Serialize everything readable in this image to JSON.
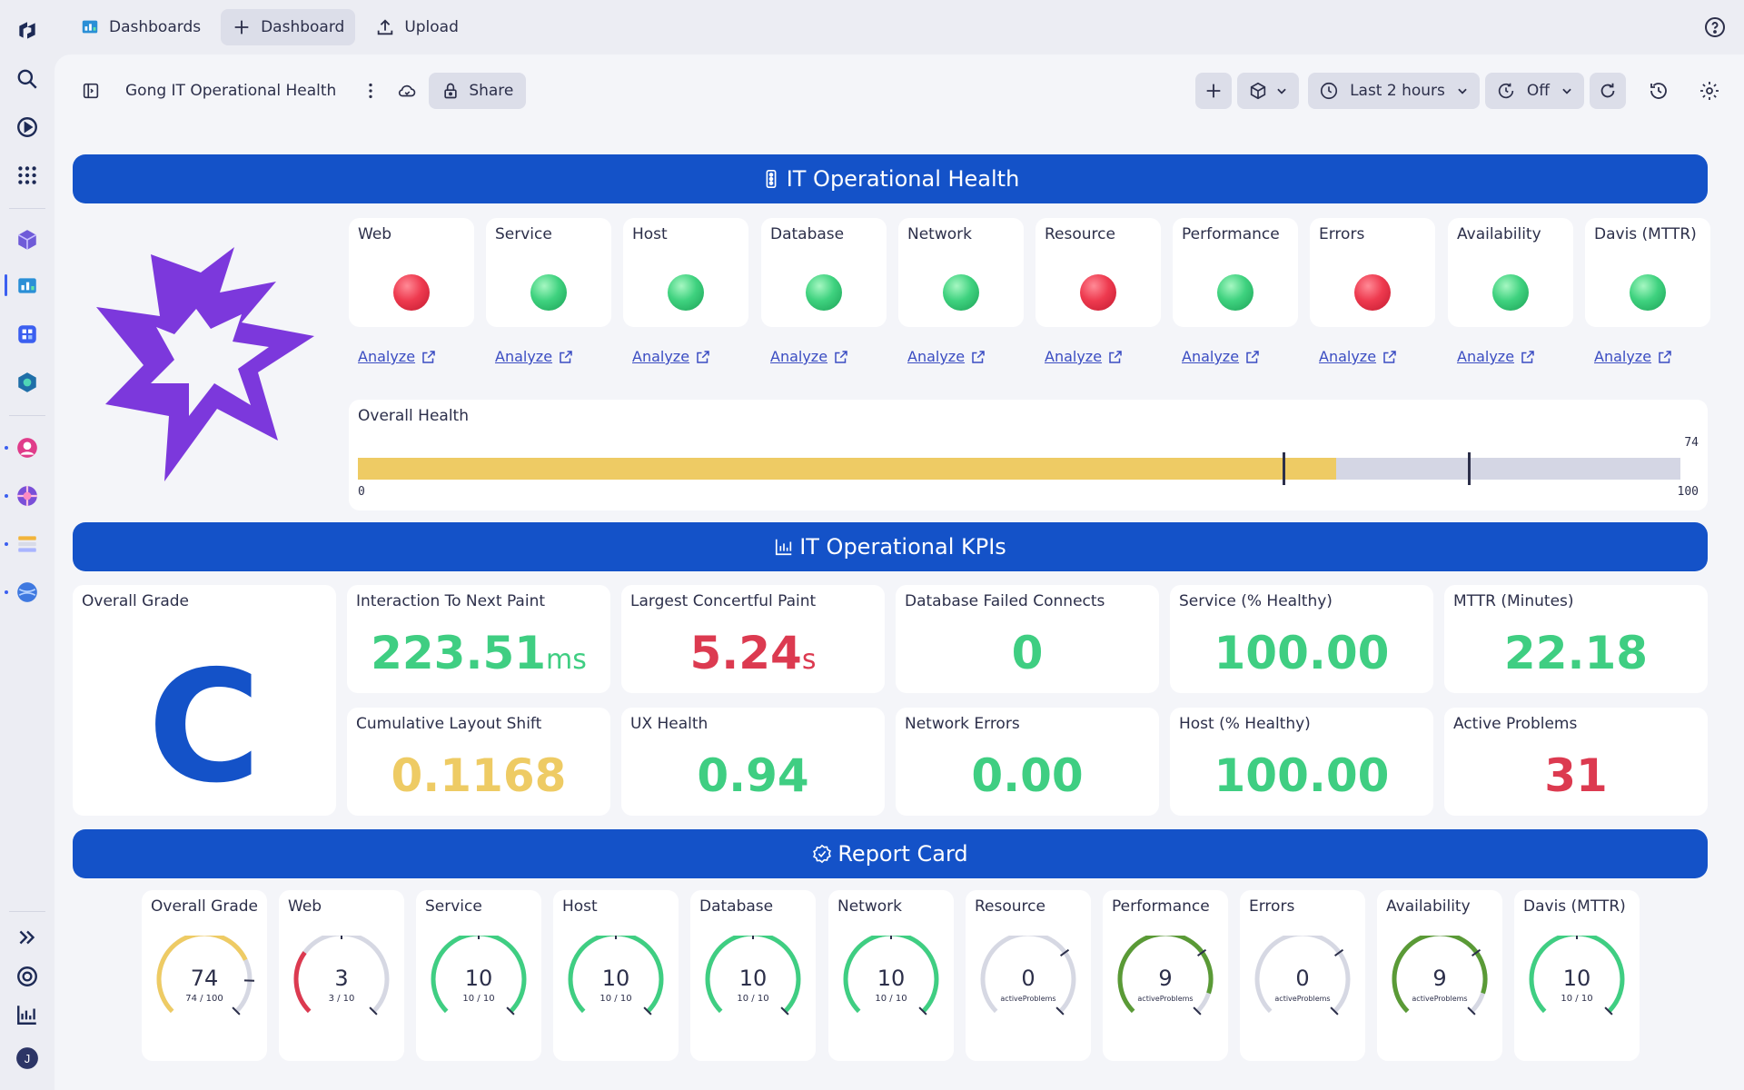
{
  "topbar": {
    "dashboards_label": "Dashboards",
    "new_dashboard_label": "Dashboard",
    "upload_label": "Upload"
  },
  "dashboard": {
    "title": "Gong IT Operational Health",
    "share_label": "Share",
    "timeframe_label": "Last 2 hours",
    "refresh_label": "Off"
  },
  "colors": {
    "header_blue": "#1452c8",
    "good_green": "#3fce82",
    "bad_red": "#dc3a50",
    "warn_yellow": "#eecb64",
    "olive_green": "#5a9a36"
  },
  "sections": {
    "health_title": "IT Operational Health",
    "kpi_title": "IT Operational KPIs",
    "report_title": "Report Card"
  },
  "health_tiles": [
    {
      "label": "Web",
      "status": "red",
      "analyze": "Analyze"
    },
    {
      "label": "Service",
      "status": "green",
      "analyze": "Analyze"
    },
    {
      "label": "Host",
      "status": "green",
      "analyze": "Analyze"
    },
    {
      "label": "Database",
      "status": "green",
      "analyze": "Analyze"
    },
    {
      "label": "Network",
      "status": "green",
      "analyze": "Analyze"
    },
    {
      "label": "Resource",
      "status": "red",
      "analyze": "Analyze"
    },
    {
      "label": "Performance",
      "status": "green",
      "analyze": "Analyze"
    },
    {
      "label": "Errors",
      "status": "red",
      "analyze": "Analyze"
    },
    {
      "label": "Availability",
      "status": "green",
      "analyze": "Analyze"
    },
    {
      "label": "Davis (MTTR)",
      "status": "green",
      "analyze": "Analyze"
    }
  ],
  "overall_health": {
    "label": "Overall Health",
    "value": 74,
    "value_label": "74",
    "min_label": "0",
    "max_label": "100",
    "min": 0,
    "max": 100,
    "thresholds": [
      70,
      84
    ]
  },
  "kpis": {
    "overall_grade_label": "Overall Grade",
    "overall_grade": "C",
    "items": [
      {
        "label": "Interaction To Next Paint",
        "value": "223.51",
        "unit": "ms",
        "color": "#3fce82"
      },
      {
        "label": "Largest Concertful Paint",
        "value": "5.24",
        "unit": "s",
        "color": "#dc3a50"
      },
      {
        "label": "Database Failed Connects",
        "value": "0",
        "unit": "",
        "color": "#3fce82"
      },
      {
        "label": "Service (% Healthy)",
        "value": "100.00",
        "unit": "",
        "color": "#3fce82"
      },
      {
        "label": "MTTR (Minutes)",
        "value": "22.18",
        "unit": "",
        "color": "#3fce82"
      },
      {
        "label": "Cumulative Layout Shift",
        "value": "0.1168",
        "unit": "",
        "color": "#eecb64"
      },
      {
        "label": "UX Health",
        "value": "0.94",
        "unit": "",
        "color": "#3fce82"
      },
      {
        "label": "Network Errors",
        "value": "0.00",
        "unit": "",
        "color": "#3fce82"
      },
      {
        "label": "Host (% Healthy)",
        "value": "100.00",
        "unit": "",
        "color": "#3fce82"
      },
      {
        "label": "Active Problems",
        "value": "31",
        "unit": "",
        "color": "#dc3a50"
      }
    ]
  },
  "report_card": [
    {
      "label": "Overall Grade",
      "value": "74",
      "sub": "74 / 100",
      "fraction": 0.74,
      "marker": 0.84,
      "color": "#eecb64"
    },
    {
      "label": "Web",
      "value": "3",
      "sub": "3 / 10",
      "fraction": 0.3,
      "marker": 0.5,
      "color": "#dc3a50"
    },
    {
      "label": "Service",
      "value": "10",
      "sub": "10 / 10",
      "fraction": 1.0,
      "marker": 0.5,
      "color": "#3fce82"
    },
    {
      "label": "Host",
      "value": "10",
      "sub": "10 / 10",
      "fraction": 1.0,
      "marker": 0.5,
      "color": "#3fce82"
    },
    {
      "label": "Database",
      "value": "10",
      "sub": "10 / 10",
      "fraction": 1.0,
      "marker": 0.5,
      "color": "#3fce82"
    },
    {
      "label": "Network",
      "value": "10",
      "sub": "10 / 10",
      "fraction": 1.0,
      "marker": 0.5,
      "color": "#3fce82"
    },
    {
      "label": "Resource",
      "value": "0",
      "sub": "activeProblems",
      "fraction": 0.0,
      "marker": 0.7,
      "color": "#3fce82"
    },
    {
      "label": "Performance",
      "value": "9",
      "sub": "activeProblems",
      "fraction": 0.9,
      "marker": 0.7,
      "color": "#5a9a36"
    },
    {
      "label": "Errors",
      "value": "0",
      "sub": "activeProblems",
      "fraction": 0.0,
      "marker": 0.7,
      "color": "#3fce82"
    },
    {
      "label": "Availability",
      "value": "9",
      "sub": "activeProblems",
      "fraction": 0.9,
      "marker": 0.7,
      "color": "#5a9a36"
    },
    {
      "label": "Davis (MTTR)",
      "value": "10",
      "sub": "10 / 10",
      "fraction": 1.0,
      "marker": 0.5,
      "color": "#3fce82"
    }
  ]
}
